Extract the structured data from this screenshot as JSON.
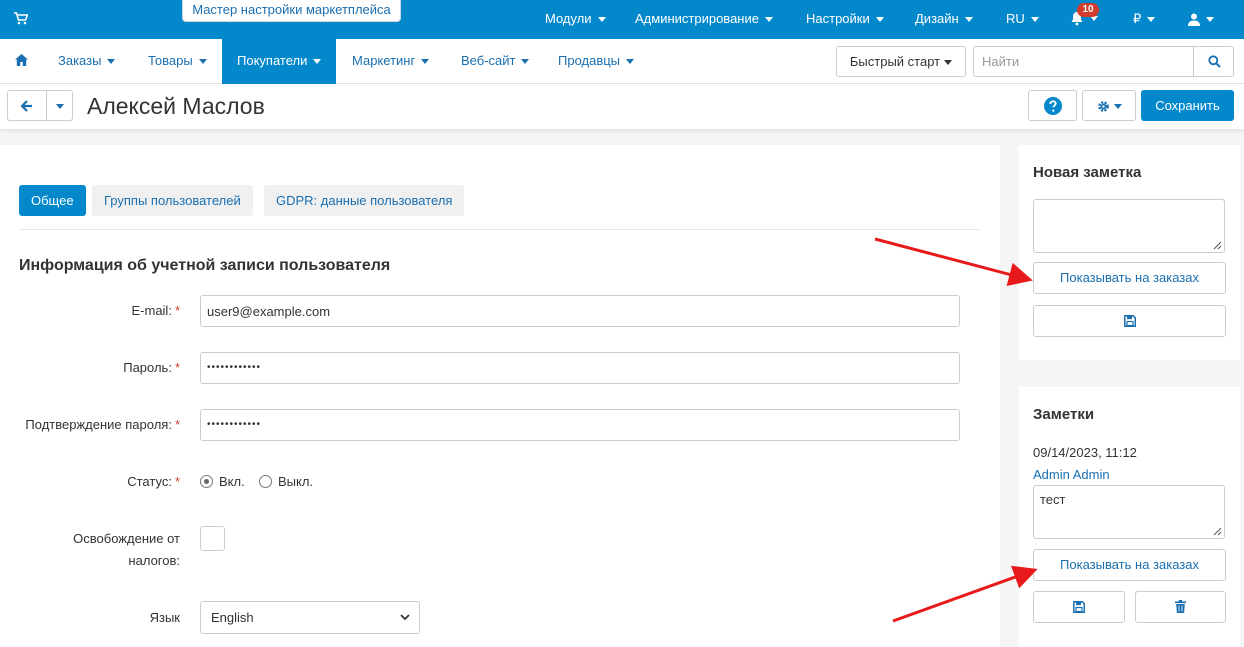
{
  "topbar": {
    "wizard_label": "Мастер настройки маркетплейса",
    "menu": [
      "Модули",
      "Администрирование",
      "Настройки",
      "Дизайн",
      "RU"
    ],
    "notifications_count": "10",
    "currency": "₽",
    "icons": [
      "cart-icon",
      "bell-icon",
      "user-icon"
    ]
  },
  "nav": {
    "items": [
      "Заказы",
      "Товары",
      "Покупатели",
      "Маркетинг",
      "Веб-сайт",
      "Продавцы"
    ],
    "active": "Покупатели",
    "quick_start": "Быстрый старт",
    "search_placeholder": "Найти"
  },
  "titlebar": {
    "title": "Алексей Маслов",
    "save_label": "Сохранить"
  },
  "tabs": [
    "Общее",
    "Группы пользователей",
    "GDPR: данные пользователя"
  ],
  "form": {
    "section_title": "Информация об учетной записи пользователя",
    "email_label": "E-mail:",
    "email_value": "user9@example.com",
    "password_label": "Пароль:",
    "password_value": "••••••••••••",
    "confirm_label": "Подтверждение пароля:",
    "confirm_value": "••••••••••••",
    "status_label": "Статус:",
    "status_on": "Вкл.",
    "status_off": "Выкл.",
    "status_selected": "Вкл.",
    "tax_label_1": "Освобождение от",
    "tax_label_2": "налогов:",
    "language_label": "Язык",
    "language_value": "English"
  },
  "new_note": {
    "title": "Новая заметка",
    "show_on_orders": "Показывать на заказах"
  },
  "notes": {
    "title": "Заметки",
    "date": "09/14/2023, 11:12",
    "author": "Admin Admin",
    "text": "тест",
    "show_on_orders": "Показывать на заказах"
  },
  "colors": {
    "primary": "#0388cc",
    "link": "#1a6fb0",
    "required": "#d33c2c",
    "arrow": "#e8191b"
  }
}
